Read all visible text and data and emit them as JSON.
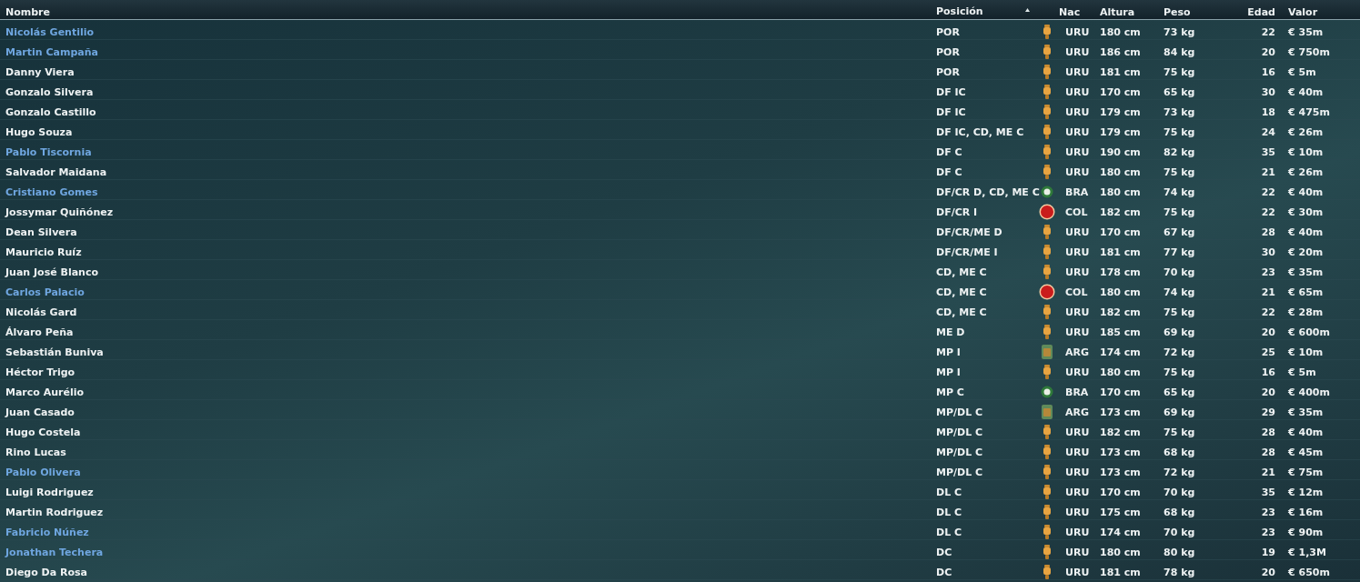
{
  "table": {
    "columns": [
      {
        "label": "Nombre",
        "sorted": false
      },
      {
        "label": "Posición",
        "sorted": true
      },
      {
        "label": "Nac",
        "sorted": false
      },
      {
        "label": "Altura",
        "sorted": false
      },
      {
        "label": "Peso",
        "sorted": false
      },
      {
        "label": "Edad",
        "sorted": false
      },
      {
        "label": "Valor",
        "sorted": false
      }
    ],
    "rows": [
      {
        "name": "Nicolás Gentilio",
        "highlighted": true,
        "position": "POR",
        "kind": "uru",
        "nationality": "URU",
        "height": "180 cm",
        "weight": "73 kg",
        "age": "22",
        "value": "€ 35m"
      },
      {
        "name": "Martin Campaña",
        "highlighted": true,
        "position": "POR",
        "kind": "uru",
        "nationality": "URU",
        "height": "186 cm",
        "weight": "84 kg",
        "age": "20",
        "value": "€ 750m"
      },
      {
        "name": "Danny Viera",
        "highlighted": false,
        "position": "POR",
        "kind": "uru",
        "nationality": "URU",
        "height": "181 cm",
        "weight": "75 kg",
        "age": "16",
        "value": "€ 5m"
      },
      {
        "name": "Gonzalo Silvera",
        "highlighted": false,
        "position": "DF IC",
        "kind": "uru",
        "nationality": "URU",
        "height": "170 cm",
        "weight": "65 kg",
        "age": "30",
        "value": "€ 40m"
      },
      {
        "name": "Gonzalo Castillo",
        "highlighted": false,
        "position": "DF IC",
        "kind": "uru",
        "nationality": "URU",
        "height": "179 cm",
        "weight": "73 kg",
        "age": "18",
        "value": "€ 475m"
      },
      {
        "name": "Hugo Souza",
        "highlighted": false,
        "position": "DF IC, CD, ME C",
        "kind": "uru",
        "nationality": "URU",
        "height": "179 cm",
        "weight": "75 kg",
        "age": "24",
        "value": "€ 26m"
      },
      {
        "name": "Pablo Tiscornia",
        "highlighted": true,
        "position": "DF C",
        "kind": "uru",
        "nationality": "URU",
        "height": "190 cm",
        "weight": "82 kg",
        "age": "35",
        "value": "€ 10m"
      },
      {
        "name": "Salvador Maidana",
        "highlighted": false,
        "position": "DF C",
        "kind": "uru",
        "nationality": "URU",
        "height": "180 cm",
        "weight": "75 kg",
        "age": "21",
        "value": "€ 26m"
      },
      {
        "name": "Cristiano Gomes",
        "highlighted": true,
        "position": "DF/CR D, CD, ME C",
        "kind": "bra",
        "nationality": "BRA",
        "height": "180 cm",
        "weight": "74 kg",
        "age": "22",
        "value": "€ 40m"
      },
      {
        "name": "Jossymar Quiñónez",
        "highlighted": false,
        "position": "DF/CR I",
        "kind": "col",
        "nationality": "COL",
        "height": "182 cm",
        "weight": "75 kg",
        "age": "22",
        "value": "€ 30m"
      },
      {
        "name": "Dean Silvera",
        "highlighted": false,
        "position": "DF/CR/ME D",
        "kind": "uru",
        "nationality": "URU",
        "height": "170 cm",
        "weight": "67 kg",
        "age": "28",
        "value": "€ 40m"
      },
      {
        "name": "Mauricio Ruíz",
        "highlighted": false,
        "position": "DF/CR/ME I",
        "kind": "uru",
        "nationality": "URU",
        "height": "181 cm",
        "weight": "77 kg",
        "age": "30",
        "value": "€ 20m"
      },
      {
        "name": "Juan José Blanco",
        "highlighted": false,
        "position": "CD, ME C",
        "kind": "uru",
        "nationality": "URU",
        "height": "178 cm",
        "weight": "70 kg",
        "age": "23",
        "value": "€ 35m"
      },
      {
        "name": "Carlos Palacio",
        "highlighted": true,
        "position": "CD, ME C",
        "kind": "col",
        "nationality": "COL",
        "height": "180 cm",
        "weight": "74 kg",
        "age": "21",
        "value": "€ 65m"
      },
      {
        "name": "Nicolás Gard",
        "highlighted": false,
        "position": "CD, ME C",
        "kind": "uru",
        "nationality": "URU",
        "height": "182 cm",
        "weight": "75 kg",
        "age": "22",
        "value": "€ 28m"
      },
      {
        "name": "Álvaro Peña",
        "highlighted": false,
        "position": "ME D",
        "kind": "uru",
        "nationality": "URU",
        "height": "185 cm",
        "weight": "69 kg",
        "age": "20",
        "value": "€ 600m"
      },
      {
        "name": "Sebastián Buniva",
        "highlighted": false,
        "position": "MP I",
        "kind": "arg",
        "nationality": "ARG",
        "height": "174 cm",
        "weight": "72 kg",
        "age": "25",
        "value": "€ 10m"
      },
      {
        "name": "Héctor Trigo",
        "highlighted": false,
        "position": "MP I",
        "kind": "uru",
        "nationality": "URU",
        "height": "180 cm",
        "weight": "75 kg",
        "age": "16",
        "value": "€ 5m"
      },
      {
        "name": "Marco Aurélio",
        "highlighted": false,
        "position": "MP C",
        "kind": "bra",
        "nationality": "BRA",
        "height": "170 cm",
        "weight": "65 kg",
        "age": "20",
        "value": "€ 400m"
      },
      {
        "name": "Juan Casado",
        "highlighted": false,
        "position": "MP/DL C",
        "kind": "arg",
        "nationality": "ARG",
        "height": "173 cm",
        "weight": "69 kg",
        "age": "29",
        "value": "€ 35m"
      },
      {
        "name": "Hugo Costela",
        "highlighted": false,
        "position": "MP/DL C",
        "kind": "uru",
        "nationality": "URU",
        "height": "182 cm",
        "weight": "75 kg",
        "age": "28",
        "value": "€ 40m"
      },
      {
        "name": "Rino Lucas",
        "highlighted": false,
        "position": "MP/DL C",
        "kind": "uru",
        "nationality": "URU",
        "height": "173 cm",
        "weight": "68 kg",
        "age": "28",
        "value": "€ 45m"
      },
      {
        "name": "Pablo Olivera",
        "highlighted": true,
        "position": "MP/DL C",
        "kind": "uru",
        "nationality": "URU",
        "height": "173 cm",
        "weight": "72 kg",
        "age": "21",
        "value": "€ 75m"
      },
      {
        "name": "Luigi Rodriguez",
        "highlighted": false,
        "position": "DL C",
        "kind": "uru",
        "nationality": "URU",
        "height": "170 cm",
        "weight": "70 kg",
        "age": "35",
        "value": "€ 12m"
      },
      {
        "name": "Martin Rodriguez",
        "highlighted": false,
        "position": "DL C",
        "kind": "uru",
        "nationality": "URU",
        "height": "175 cm",
        "weight": "68 kg",
        "age": "23",
        "value": "€ 16m"
      },
      {
        "name": "Fabricio Núñez",
        "highlighted": true,
        "position": "DL C",
        "kind": "uru",
        "nationality": "URU",
        "height": "174 cm",
        "weight": "70 kg",
        "age": "23",
        "value": "€ 90m"
      },
      {
        "name": "Jonathan Techera",
        "highlighted": true,
        "position": "DC",
        "kind": "uru",
        "nationality": "URU",
        "height": "180 cm",
        "weight": "80 kg",
        "age": "19",
        "value": "€ 1,3M"
      },
      {
        "name": "Diego Da Rosa",
        "highlighted": false,
        "position": "DC",
        "kind": "uru",
        "nationality": "URU",
        "height": "181 cm",
        "weight": "78 kg",
        "age": "20",
        "value": "€ 650m"
      }
    ]
  }
}
